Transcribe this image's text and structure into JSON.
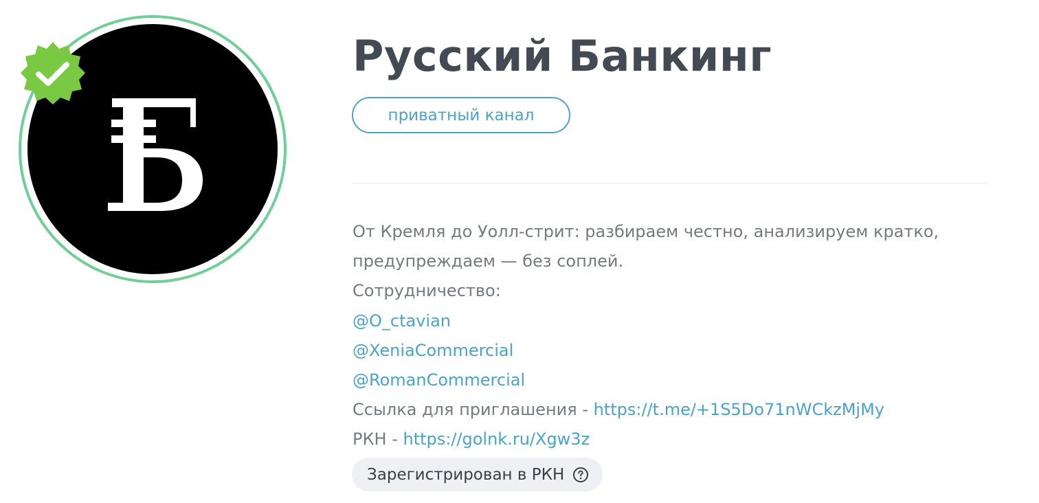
{
  "channel": {
    "title": "Русский Банкинг",
    "type_label": "приватный канал",
    "avatar_icon": "ruble-b-logo-icon",
    "verified_icon": "verified-check-icon"
  },
  "description": {
    "line1": "От Кремля до Уолл-стрит: разбираем честно, анализируем кратко,",
    "line2": "предупреждаем — без соплей.",
    "line3": "Сотрудничество:",
    "contact1": "@O_ctavian",
    "contact2": "@XeniaCommercial",
    "contact3": "@RomanCommercial",
    "invite_prefix": "Ссылка для приглашения - ",
    "invite_link": "https://t.me/+1S5Do71nWCkzMjMy",
    "rkn_prefix": "РКН - ",
    "rkn_link": "https://golnk.ru/Xgw3z"
  },
  "badge": {
    "label": "Зарегистрирован в РКН",
    "icon": "question-circle-icon"
  },
  "colors": {
    "accent": "#4aa3c8",
    "ring": "#6fcf97",
    "verified": "#7ac943",
    "title": "#434a54",
    "text": "#747a82",
    "badge_bg": "#eef0f3"
  }
}
